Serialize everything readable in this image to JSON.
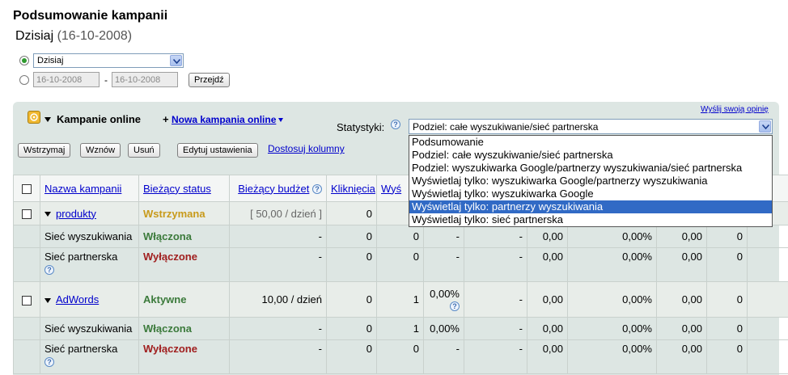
{
  "page": {
    "title": "Podsumowanie kampanii",
    "date_label": "Dzisiaj",
    "date_value": "(16-10-2008)"
  },
  "range": {
    "selected": "Dzisiaj",
    "from": "16-10-2008",
    "to": "16-10-2008",
    "separator": "-",
    "go_label": "Przejdź"
  },
  "panel": {
    "feedback_link": "Wyślij swoją opinię",
    "campaigns_label": "Kampanie online",
    "new_campaign_prefix": "+",
    "new_campaign_link": "Nowa kampania online",
    "stats_label": "Statystyki:",
    "stats_selected": "Podziel: całe wyszukiwanie/sieć partnerska",
    "options": [
      "Podsumowanie",
      "Podziel: całe wyszukiwanie/sieć partnerska",
      "Podziel: wyszukiwarka Google/partnerzy wyszukiwania/sieć partnerska",
      "Wyświetlaj tylko: wyszukiwarka Google/partnerzy wyszukiwania",
      "Wyświetlaj tylko: wyszukiwarka Google",
      "Wyświetlaj tylko: partnerzy wyszukiwania",
      "Wyświetlaj tylko: sieć partnerska"
    ],
    "highlighted_option": 5
  },
  "toolbar": {
    "pause": "Wstrzymaj",
    "resume": "Wznów",
    "delete": "Usuń",
    "edit": "Edytuj ustawienia",
    "columns": "Dostosuj kolumny"
  },
  "table": {
    "headers": {
      "name": "Nazwa kampanii",
      "status": "Bieżący status",
      "budget": "Bieżący budżet",
      "clicks": "Kliknięcia",
      "impr": "Wyś"
    },
    "rows": [
      {
        "name": "produkty",
        "status": "Wstrzymana",
        "budget": "[ 50,00 / dzień ]",
        "clicks": "0",
        "impr": "",
        "ctr": "",
        "cpc": "",
        "cost": "",
        "c1": "",
        "c2": "",
        "c3": ""
      },
      {
        "name": "Sieć wyszukiwania",
        "status": "Włączona",
        "budget": "-",
        "clicks": "0",
        "impr": "0",
        "ctr": "-",
        "cpc": "-",
        "cost": "0,00",
        "c1": "0,00%",
        "c2": "0,00",
        "c3": "0"
      },
      {
        "name": "Sieć partnerska",
        "status": "Wyłączone",
        "budget": "-",
        "clicks": "0",
        "impr": "0",
        "ctr": "-",
        "cpc": "-",
        "cost": "0,00",
        "c1": "0,00%",
        "c2": "0,00",
        "c3": "0"
      },
      {
        "name": "AdWords",
        "status": "Aktywne",
        "budget": "10,00 / dzień",
        "clicks": "0",
        "impr": "1",
        "ctr": "0,00%",
        "cpc": "-",
        "cost": "0,00",
        "c1": "0,00%",
        "c2": "0,00",
        "c3": "0"
      },
      {
        "name": "Sieć wyszukiwania",
        "status": "Włączona",
        "budget": "-",
        "clicks": "0",
        "impr": "1",
        "ctr": "0,00%",
        "cpc": "-",
        "cost": "0,00",
        "c1": "0,00%",
        "c2": "0,00",
        "c3": "0"
      },
      {
        "name": "Sieć partnerska",
        "status": "Wyłączone",
        "budget": "-",
        "clicks": "0",
        "impr": "0",
        "ctr": "-",
        "cpc": "-",
        "cost": "0,00",
        "c1": "0,00%",
        "c2": "0,00",
        "c3": "0"
      }
    ]
  },
  "icons": {
    "help": "?"
  }
}
